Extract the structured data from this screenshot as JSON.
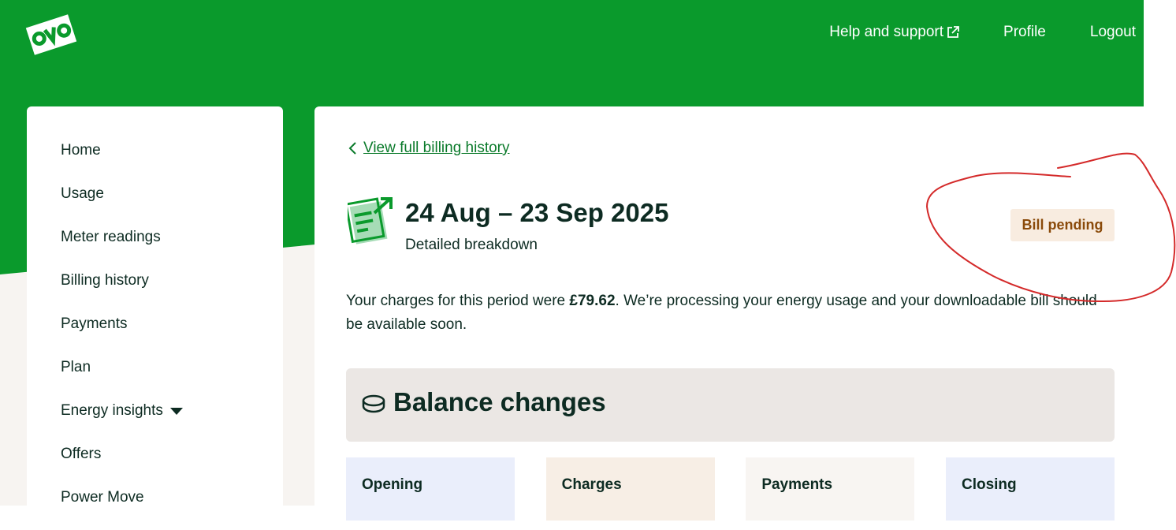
{
  "header": {
    "nav": [
      {
        "label": "Help and support",
        "external": true
      },
      {
        "label": "Profile"
      },
      {
        "label": "Logout"
      }
    ]
  },
  "sidebar": {
    "items": [
      {
        "label": "Home"
      },
      {
        "label": "Usage"
      },
      {
        "label": "Meter readings"
      },
      {
        "label": "Billing history"
      },
      {
        "label": "Payments"
      },
      {
        "label": "Plan"
      },
      {
        "label": "Energy insights",
        "has_dropdown": true
      },
      {
        "label": "Offers"
      },
      {
        "label": "Power Move"
      }
    ]
  },
  "main": {
    "back_link": "View full billing history",
    "period_title": "24 Aug – 23 Sep 2025",
    "period_subtitle": "Detailed breakdown",
    "status_badge": "Bill pending",
    "charges_prefix": "Your charges for this period were ",
    "charges_amount": "£79.62",
    "charges_suffix": ". We’re processing your energy usage and your downloadable bill should be available soon.",
    "balance_title": "Balance changes",
    "cards": [
      {
        "label": "Opening"
      },
      {
        "label": "Charges"
      },
      {
        "label": "Payments"
      },
      {
        "label": "Closing"
      }
    ]
  },
  "colors": {
    "brand_green": "#0a9a2c",
    "link_green": "#0a7a2a",
    "text_dark": "#0d2b22",
    "badge_bg": "#f8ece0",
    "badge_text": "#8a4a0a",
    "annotation_red": "#d42a2a"
  },
  "icons": {
    "logo": "ovo-logo",
    "external": "external-link-icon",
    "back": "chevron-left-icon",
    "bill": "bill-document-icon",
    "balance": "coin-stack-icon",
    "dropdown": "caret-down-icon"
  }
}
